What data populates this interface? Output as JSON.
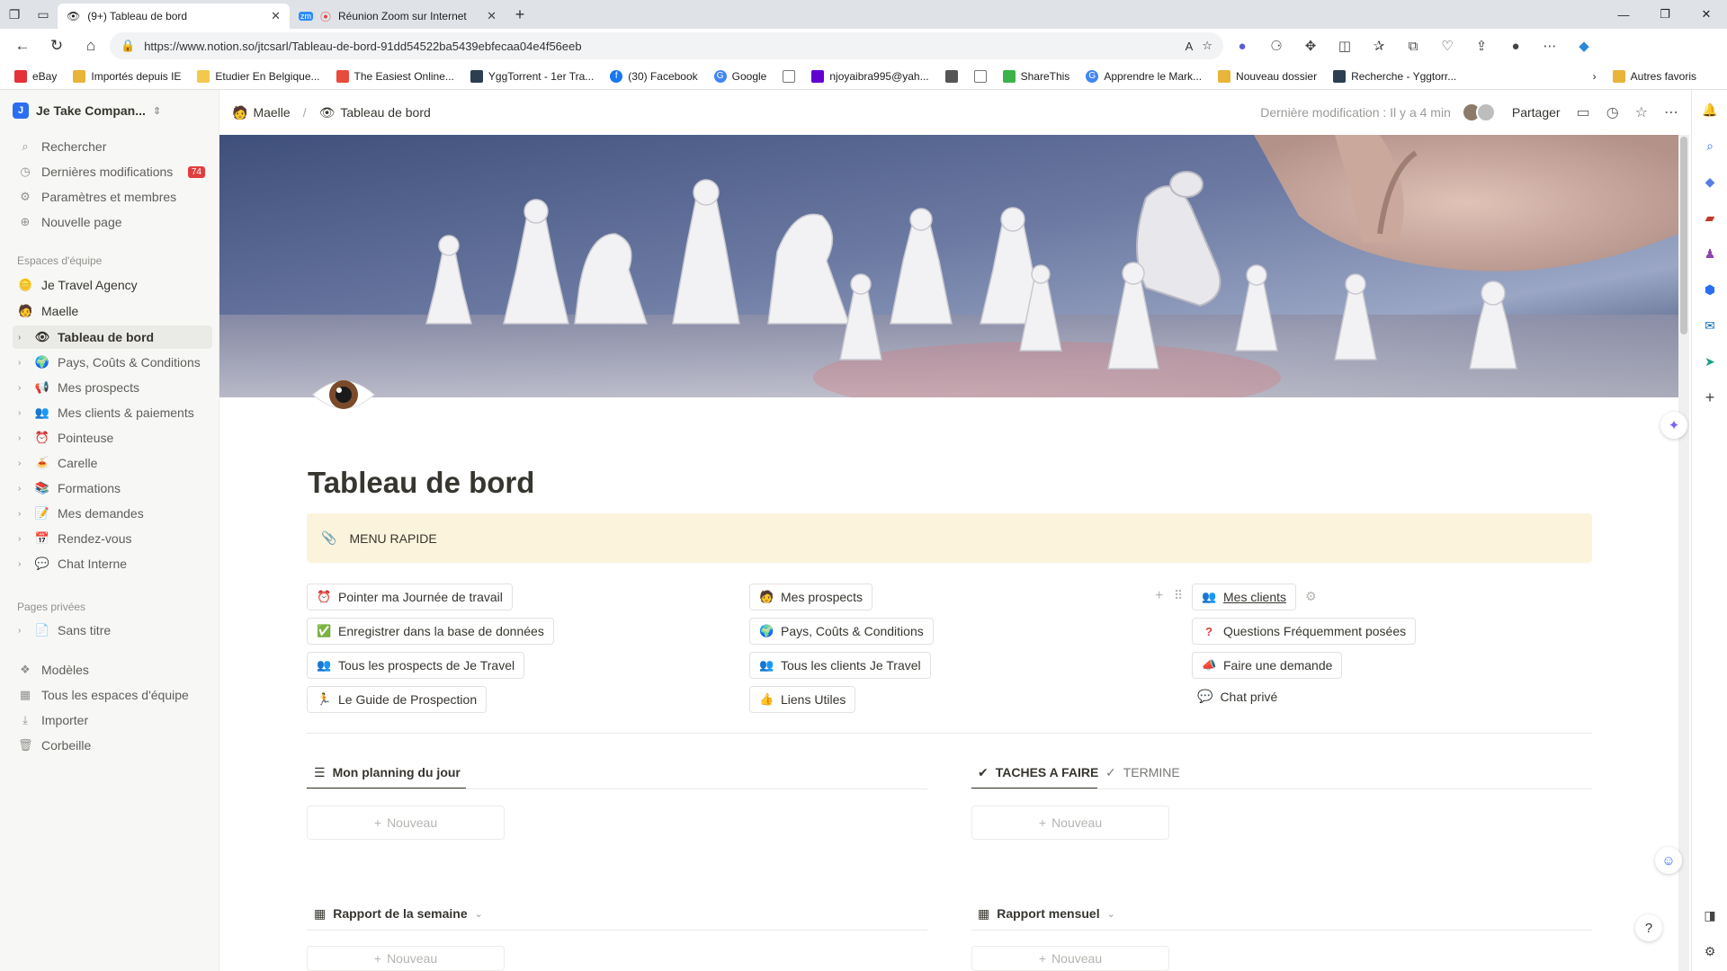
{
  "browser": {
    "tabs": [
      {
        "label": "(9+) Tableau de bord",
        "active": true
      },
      {
        "label": "Réunion Zoom sur Internet",
        "active": false
      }
    ],
    "url": "https://www.notion.so/jtcsarl/Tableau-de-bord-91dd54522ba5439ebfecaa04e4f56eeb",
    "bookmarks": [
      {
        "label": "eBay",
        "color": "#e53238"
      },
      {
        "label": "Importés depuis IE",
        "color": "#e8b43a"
      },
      {
        "label": "Etudier En Belgique...",
        "color": "#f2c94c"
      },
      {
        "label": "The Easiest Online...",
        "color": "#e74c3c"
      },
      {
        "label": "YggTorrent - 1er Tra...",
        "color": "#2c3e50"
      },
      {
        "label": "(30) Facebook",
        "color": "#1877f2"
      },
      {
        "label": "Google",
        "color": "#4285f4"
      },
      {
        "label": "",
        "color": "#777777"
      },
      {
        "label": "njoyaibra995@yah...",
        "color": "#6001d2"
      },
      {
        "label": "",
        "color": "#555555"
      },
      {
        "label": "",
        "color": "#777777"
      },
      {
        "label": "ShareThis",
        "color": "#3bb34a"
      },
      {
        "label": "Apprendre le Mark...",
        "color": "#4285f4"
      },
      {
        "label": "Nouveau dossier",
        "color": "#e8b43a"
      },
      {
        "label": "Recherche - Yggtorr...",
        "color": "#2c3e50"
      }
    ],
    "bookmarks_more": "Autres favoris"
  },
  "workspace": {
    "name": "Je Take Compan..."
  },
  "sidebar": {
    "top_items": [
      {
        "label": "Rechercher",
        "icon": "search-icon"
      },
      {
        "label": "Dernières modifications",
        "icon": "clock-icon",
        "badge": "74"
      },
      {
        "label": "Paramètres et membres",
        "icon": "gear-icon"
      },
      {
        "label": "Nouvelle page",
        "icon": "plus-circle-icon"
      }
    ],
    "team_section": "Espaces d'équipe",
    "teams": [
      {
        "label": "Je Travel Agency",
        "icon": "🪙"
      },
      {
        "label": "Maelle",
        "icon": "🧑"
      }
    ],
    "pages": [
      {
        "label": "Tableau de bord",
        "icon": "👁",
        "selected": true
      },
      {
        "label": "Pays, Coûts & Conditions",
        "icon": "🌍"
      },
      {
        "label": "Mes prospects",
        "icon": "📢"
      },
      {
        "label": "Mes clients & paiements",
        "icon": "👥"
      },
      {
        "label": "Pointeuse",
        "icon": "⏰"
      },
      {
        "label": "Carelle",
        "icon": "🍝"
      },
      {
        "label": "Formations",
        "icon": "📚"
      },
      {
        "label": "Mes demandes",
        "icon": "📝"
      },
      {
        "label": "Rendez-vous",
        "icon": "📅"
      },
      {
        "label": "Chat Interne",
        "icon": "💬"
      }
    ],
    "private_section": "Pages privées",
    "private_pages": [
      {
        "label": "Sans titre",
        "icon": "📄"
      }
    ],
    "bottom_items": [
      {
        "label": "Modèles",
        "icon": "templates-icon"
      },
      {
        "label": "Tous les espaces d'équipe",
        "icon": "grid-icon"
      },
      {
        "label": "Importer",
        "icon": "download-icon"
      },
      {
        "label": "Corbeille",
        "icon": "trash-icon"
      }
    ]
  },
  "topbar": {
    "breadcrumb": [
      "Maelle",
      "Tableau de bord"
    ],
    "last_edited": "Dernière modification : Il y a 4 min",
    "share": "Partager"
  },
  "page": {
    "title": "Tableau de bord",
    "callout": "MENU RAPIDE",
    "links": {
      "col1": [
        {
          "label": "Pointer ma Journée de travail",
          "icon": "⏰"
        },
        {
          "label": "Enregistrer dans la base de données",
          "icon": "✅"
        },
        {
          "label": "Tous les prospects de Je Travel",
          "icon": "👥"
        },
        {
          "label": "Le Guide de Prospection",
          "icon": "🏃"
        }
      ],
      "col2": [
        {
          "label": "Mes prospects",
          "icon": "🧑"
        },
        {
          "label": "Pays, Coûts & Conditions",
          "icon": "🌍"
        },
        {
          "label": "Tous les clients Je Travel",
          "icon": "👥"
        },
        {
          "label": "Liens Utiles",
          "icon": "👍"
        }
      ],
      "col3": [
        {
          "label": "Mes clients",
          "icon": "👥"
        },
        {
          "label": "Questions Fréquemment posées",
          "icon": "❓"
        },
        {
          "label": "Faire une demande",
          "icon": "📣"
        },
        {
          "label": "Chat privé",
          "icon": "💬"
        }
      ]
    },
    "planning": {
      "left_tab": "Mon planning du jour",
      "right_tabs": [
        "TACHES A FAIRE",
        "TERMINE"
      ],
      "new_label": "Nouveau"
    },
    "reports": {
      "weekly": "Rapport de la semaine",
      "monthly": "Rapport mensuel",
      "new_label": "Nouveau"
    }
  }
}
